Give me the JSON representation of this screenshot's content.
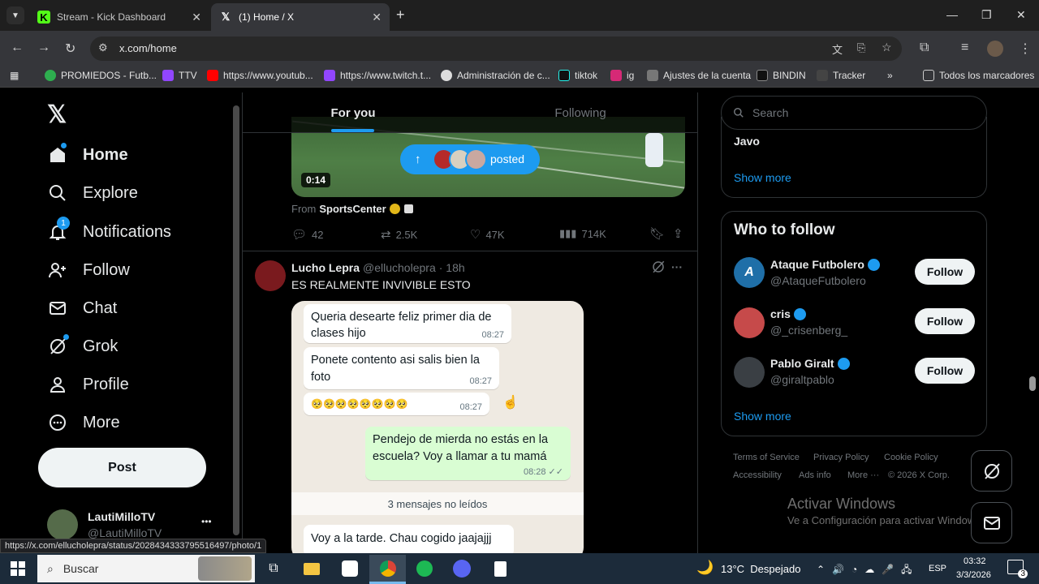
{
  "browser": {
    "tabs": [
      {
        "title": "Stream - Kick Dashboard",
        "favicon": "kick-icon"
      },
      {
        "title": "(1) Home / X",
        "favicon": "x-icon"
      }
    ],
    "url": "x.com/home",
    "bookmarks": [
      "PROMIEDOS - Futb...",
      "TTV",
      "https://www.youtub...",
      "https://www.twitch.t...",
      "Administración de c...",
      "tiktok",
      "ig",
      "Ajustes de la cuenta",
      "BINDIN",
      "Tracker"
    ],
    "all_bookmarks": "Todos los marcadores",
    "status_url": "https://x.com/ellucholepra/status/2028434333795516497/photo/1"
  },
  "sidebar": {
    "items": [
      {
        "label": "Home",
        "icon": "home-icon"
      },
      {
        "label": "Explore",
        "icon": "search-icon"
      },
      {
        "label": "Notifications",
        "icon": "bell-icon",
        "badge": "1"
      },
      {
        "label": "Follow",
        "icon": "person-add-icon"
      },
      {
        "label": "Chat",
        "icon": "mail-icon"
      },
      {
        "label": "Grok",
        "icon": "grok-icon"
      },
      {
        "label": "Profile",
        "icon": "person-icon"
      },
      {
        "label": "More",
        "icon": "more-circle-icon"
      }
    ],
    "post_button": "Post",
    "account": {
      "name": "LautiMilloTV",
      "handle": "@LautiMilloTV",
      "more": "•••"
    }
  },
  "feed": {
    "tabs": [
      "For you",
      "Following"
    ],
    "posted_pill": "posted",
    "video_time": "0:14",
    "from_prefix": "From",
    "from_account": "SportsCenter",
    "stats": {
      "replies": "42",
      "reposts": "2.5K",
      "likes": "47K",
      "views": "714K"
    },
    "post2": {
      "name": "Lucho Lepra",
      "handle": "@ellucholepra",
      "time": "· 18h",
      "more": "···",
      "text": "ES REALMENTE INVIVIBLE ESTO",
      "chat": {
        "msg1": "Queria desearte feliz primer dia de clases hijo",
        "time1": "08:27",
        "msg2": "Ponete contento asi salis bien la foto",
        "time2": "08:27",
        "msg3": "🥺🥺🥺🥺🥺🥺🥺🥺",
        "time3": "08:27",
        "msg4": "Pendejo de mierda no estás en la escuela? Voy a llamar a tu mamá",
        "time4": "08:28 ✓✓",
        "unread": "3 mensajes no leídos",
        "msg5": "Voy a la tarde. Chau cogido jaajajjj"
      }
    }
  },
  "right": {
    "search_placeholder": "Search",
    "trend_tail": "Javo",
    "show_more_1": "Show more",
    "wtf_title": "Who to follow",
    "follow_suggestions": [
      {
        "name": "Ataque Futbolero",
        "handle": "@AtaqueFutbolero",
        "button": "Follow"
      },
      {
        "name": "cris",
        "handle": "@_crisenberg_",
        "button": "Follow"
      },
      {
        "name": "Pablo Giralt",
        "handle": "@giraltpablo",
        "button": "Follow"
      }
    ],
    "show_more_2": "Show more",
    "footer": [
      "Terms of Service",
      "Privacy Policy",
      "Cookie Policy",
      "Accessibility",
      "Ads info",
      "More ···",
      "© 2026 X Corp."
    ],
    "watermark_title": "Activar Windows",
    "watermark_sub": "Ve a Configuración para activar Windows."
  },
  "taskbar": {
    "search_label": "Buscar",
    "weather": "13°C  Despejado",
    "lang": "ESP",
    "time": "03:32",
    "date": "3/3/2026",
    "notif_count": "3"
  },
  "colors": {
    "accent": "#1d9bf0",
    "background": "#000000",
    "border": "#2f3336",
    "muted": "#71767b"
  }
}
